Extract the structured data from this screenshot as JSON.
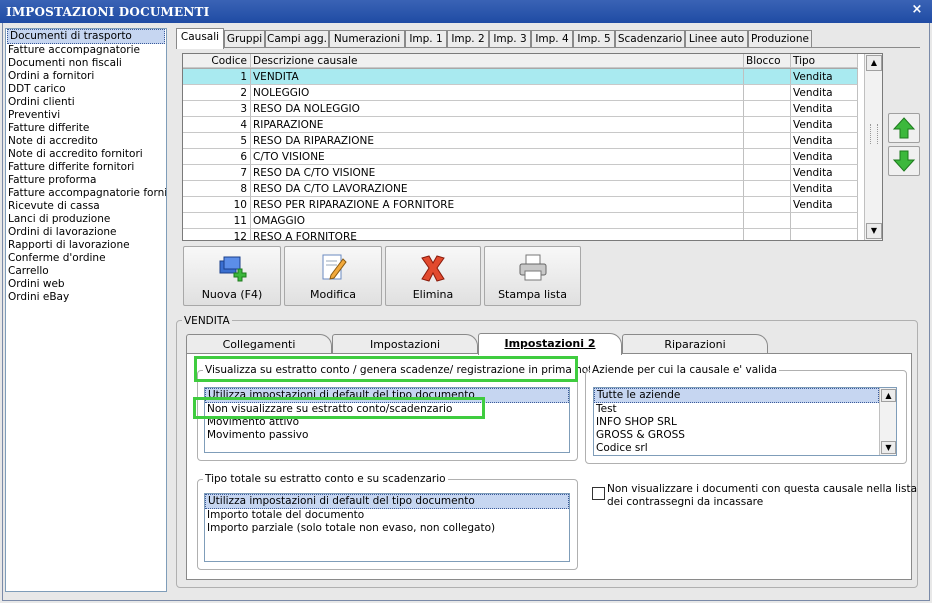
{
  "window": {
    "title": "IMPOSTAZIONI DOCUMENTI",
    "close_glyph": "×"
  },
  "doc_types": [
    "Documenti di trasporto",
    "Fatture accompagnatorie",
    "Documenti non fiscali",
    "Ordini a fornitori",
    "DDT carico",
    "Ordini clienti",
    "Preventivi",
    "Fatture differite",
    "Note di accredito",
    "Note di accredito fornitori",
    "Fatture differite fornitori",
    "Fatture proforma",
    "Fatture accompagnatorie fornito",
    "Ricevute di cassa",
    "Lanci di produzione",
    "Ordini di lavorazione",
    "Rapporti di lavorazione",
    "Conferme d'ordine",
    "Carrello",
    "Ordini web",
    "Ordini eBay"
  ],
  "tabs": [
    "Causali",
    "Gruppi",
    "Campi agg.",
    "Numerazioni",
    "Imp. 1",
    "Imp. 2",
    "Imp. 3",
    "Imp. 4",
    "Imp. 5",
    "Scadenzario",
    "Linee auto",
    "Produzione"
  ],
  "grid": {
    "columns": [
      "Codice",
      "Descrizione causale",
      "Blocco",
      "Tipo"
    ],
    "rows": [
      {
        "code": "1",
        "desc": "VENDITA",
        "blocco": "",
        "tipo": "Vendita"
      },
      {
        "code": "2",
        "desc": "NOLEGGIO",
        "blocco": "",
        "tipo": "Vendita"
      },
      {
        "code": "3",
        "desc": "RESO DA NOLEGGIO",
        "blocco": "",
        "tipo": "Vendita"
      },
      {
        "code": "4",
        "desc": "RIPARAZIONE",
        "blocco": "",
        "tipo": "Vendita"
      },
      {
        "code": "5",
        "desc": "RESO DA RIPARAZIONE",
        "blocco": "",
        "tipo": "Vendita"
      },
      {
        "code": "6",
        "desc": "C/TO VISIONE",
        "blocco": "",
        "tipo": "Vendita"
      },
      {
        "code": "7",
        "desc": "RESO DA C/TO VISIONE",
        "blocco": "",
        "tipo": "Vendita"
      },
      {
        "code": "8",
        "desc": "RESO DA C/TO LAVORAZIONE",
        "blocco": "",
        "tipo": "Vendita"
      },
      {
        "code": "10",
        "desc": "RESO PER RIPARAZIONE A FORNITORE",
        "blocco": "",
        "tipo": "Vendita"
      },
      {
        "code": "11",
        "desc": "OMAGGIO",
        "blocco": "",
        "tipo": ""
      },
      {
        "code": "12",
        "desc": "RESO A FORNITORE",
        "blocco": "",
        "tipo": ""
      }
    ]
  },
  "buttons": {
    "new": "Nuova (F4)",
    "edit": "Modifica",
    "delete": "Elimina",
    "print": "Stampa lista"
  },
  "detail": {
    "group_title": "VENDITA",
    "tabs": [
      "Collegamenti",
      "Impostazioni",
      "Impostazioni 2",
      "Riparazioni"
    ],
    "statement": {
      "title": "Visualizza su estratto conto / genera scadenze/ registrazione  in prima nota",
      "options": [
        "Utilizza impostazioni di default del tipo documento",
        "Non visualizzare su estratto conto/scadenzario",
        "Movimento attivo",
        "Movimento passivo"
      ]
    },
    "companies": {
      "title": "Aziende per cui la causale e' valida",
      "options": [
        "Tutte le aziende",
        "Test",
        "INFO SHOP SRL",
        "GROSS & GROSS",
        "Codice srl"
      ]
    },
    "total_type": {
      "title": "Tipo totale su estratto conto e su scadenzario",
      "options": [
        "Utilizza impostazioni di default del tipo documento",
        "Importo totale del documento",
        "Importo parziale (solo totale non evaso, non collegato)"
      ]
    },
    "checkbox": {
      "line1": "Non visualizzare i documenti con questa causale nella lista",
      "line2": "dei contrassegni da incassare",
      "checked": false
    }
  },
  "colors": {
    "title_bar": "#1f4ba4",
    "selected_row": "#a9eaf0",
    "highlight": "#3fcc3f"
  }
}
